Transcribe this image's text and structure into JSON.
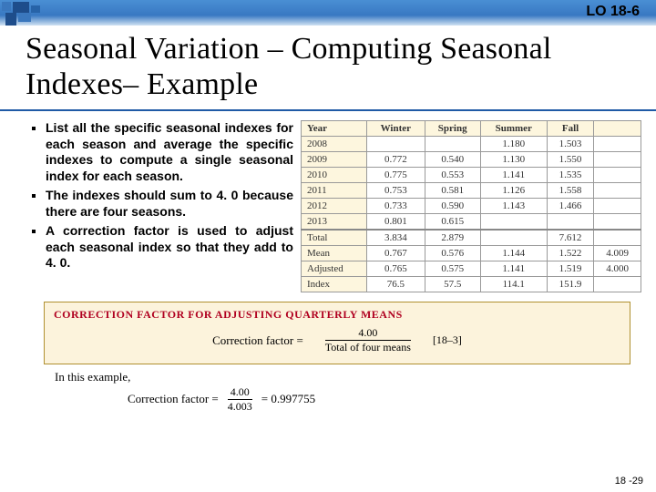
{
  "header": {
    "code": "LO 18-6"
  },
  "title": "Seasonal Variation – Computing Seasonal Indexes– Example",
  "bullets": [
    "List all the specific seasonal indexes for each season and average the specific indexes to compute a single seasonal index for each season.",
    "The indexes should sum to 4. 0 because there are four seasons.",
    "A correction factor is used to adjust each seasonal index so that they add to 4. 0."
  ],
  "table": {
    "headers": [
      "Year",
      "Winter",
      "Spring",
      "Summer",
      "Fall"
    ],
    "rows": [
      {
        "year": "2008",
        "w": "",
        "sp": "",
        "su": "1.180",
        "f": "1.503"
      },
      {
        "year": "2009",
        "w": "0.772",
        "sp": "0.540",
        "su": "1.130",
        "f": "1.550"
      },
      {
        "year": "2010",
        "w": "0.775",
        "sp": "0.553",
        "su": "1.141",
        "f": "1.535"
      },
      {
        "year": "2011",
        "w": "0.753",
        "sp": "0.581",
        "su": "1.126",
        "f": "1.558"
      },
      {
        "year": "2012",
        "w": "0.733",
        "sp": "0.590",
        "su": "1.143",
        "f": "1.466"
      },
      {
        "year": "2013",
        "w": "0.801",
        "sp": "0.615",
        "su": "",
        "f": ""
      }
    ],
    "summary": [
      {
        "label": "Total",
        "w": "3.834",
        "sp": "2.879",
        "su": "",
        "f": "7.612",
        "extra": ""
      },
      {
        "label": "Mean",
        "w": "0.767",
        "sp": "0.576",
        "su": "1.144",
        "f": "1.522",
        "extra": "4.009"
      },
      {
        "label": "Adjusted",
        "w": "0.765",
        "sp": "0.575",
        "su": "1.141",
        "f": "1.519",
        "extra": "4.000"
      },
      {
        "label": "Index",
        "w": "76.5",
        "sp": "57.5",
        "su": "114.1",
        "f": "151.9",
        "extra": ""
      }
    ]
  },
  "formula": {
    "heading": "CORRECTION FACTOR FOR ADJUSTING QUARTERLY MEANS",
    "label": "Correction factor =",
    "num": "4.00",
    "den": "Total of four means",
    "ref": "[18–3]"
  },
  "example": {
    "intro": "In this example,",
    "label": "Correction factor =",
    "num": "4.00",
    "den": "4.003",
    "result": "= 0.997755"
  },
  "page": "18 -29"
}
